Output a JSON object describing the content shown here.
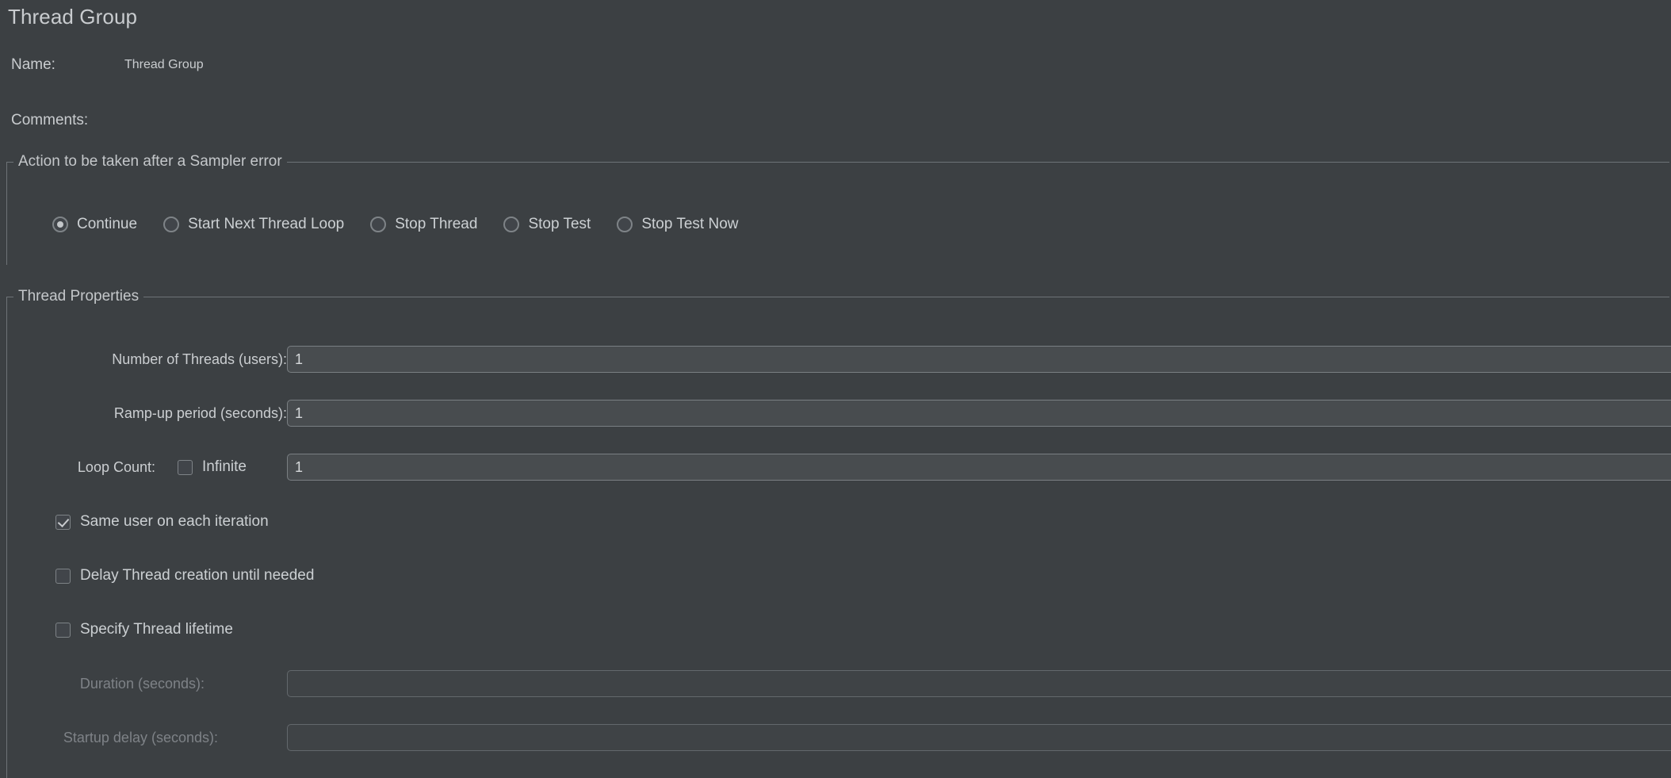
{
  "page_title": "Thread Group",
  "top_fields": [
    {
      "label": "Name:",
      "value": "Thread Group",
      "placeholder": ""
    },
    {
      "label": "Comments:",
      "value": "",
      "placeholder": ""
    }
  ],
  "sampler_error_group": {
    "title": "Action to be taken after a Sampler error",
    "options": [
      {
        "label": "Continue",
        "selected": true
      },
      {
        "label": "Start Next Thread Loop",
        "selected": false
      },
      {
        "label": "Stop Thread",
        "selected": false
      },
      {
        "label": "Stop Test",
        "selected": false
      },
      {
        "label": "Stop Test Now",
        "selected": false
      }
    ]
  },
  "thread_properties": {
    "title": "Thread Properties",
    "rows": [
      {
        "label": "Number of Threads (users):",
        "value": "1",
        "disabled": false
      },
      {
        "label": "Ramp-up period (seconds):",
        "value": "1",
        "disabled": false
      }
    ],
    "loop_count": {
      "label": "Loop Count:",
      "infinite_label": "Infinite",
      "infinite_checked": false,
      "value": "1"
    },
    "checkboxes": [
      {
        "label": "Same user on each iteration",
        "checked": true
      },
      {
        "label": "Delay Thread creation until needed",
        "checked": false
      },
      {
        "label": "Specify Thread lifetime",
        "checked": false
      }
    ],
    "lifetime_rows": [
      {
        "label": "Duration (seconds):",
        "value": "",
        "disabled": true
      },
      {
        "label": "Startup delay (seconds):",
        "value": "",
        "disabled": true
      }
    ]
  },
  "colors": {
    "background": "#3c4043",
    "field_background": "#484c4f",
    "field_border": "#7a7f83",
    "text": "#cbced1",
    "disabled_text": "#7e8287",
    "group_border": "#6e7377"
  }
}
